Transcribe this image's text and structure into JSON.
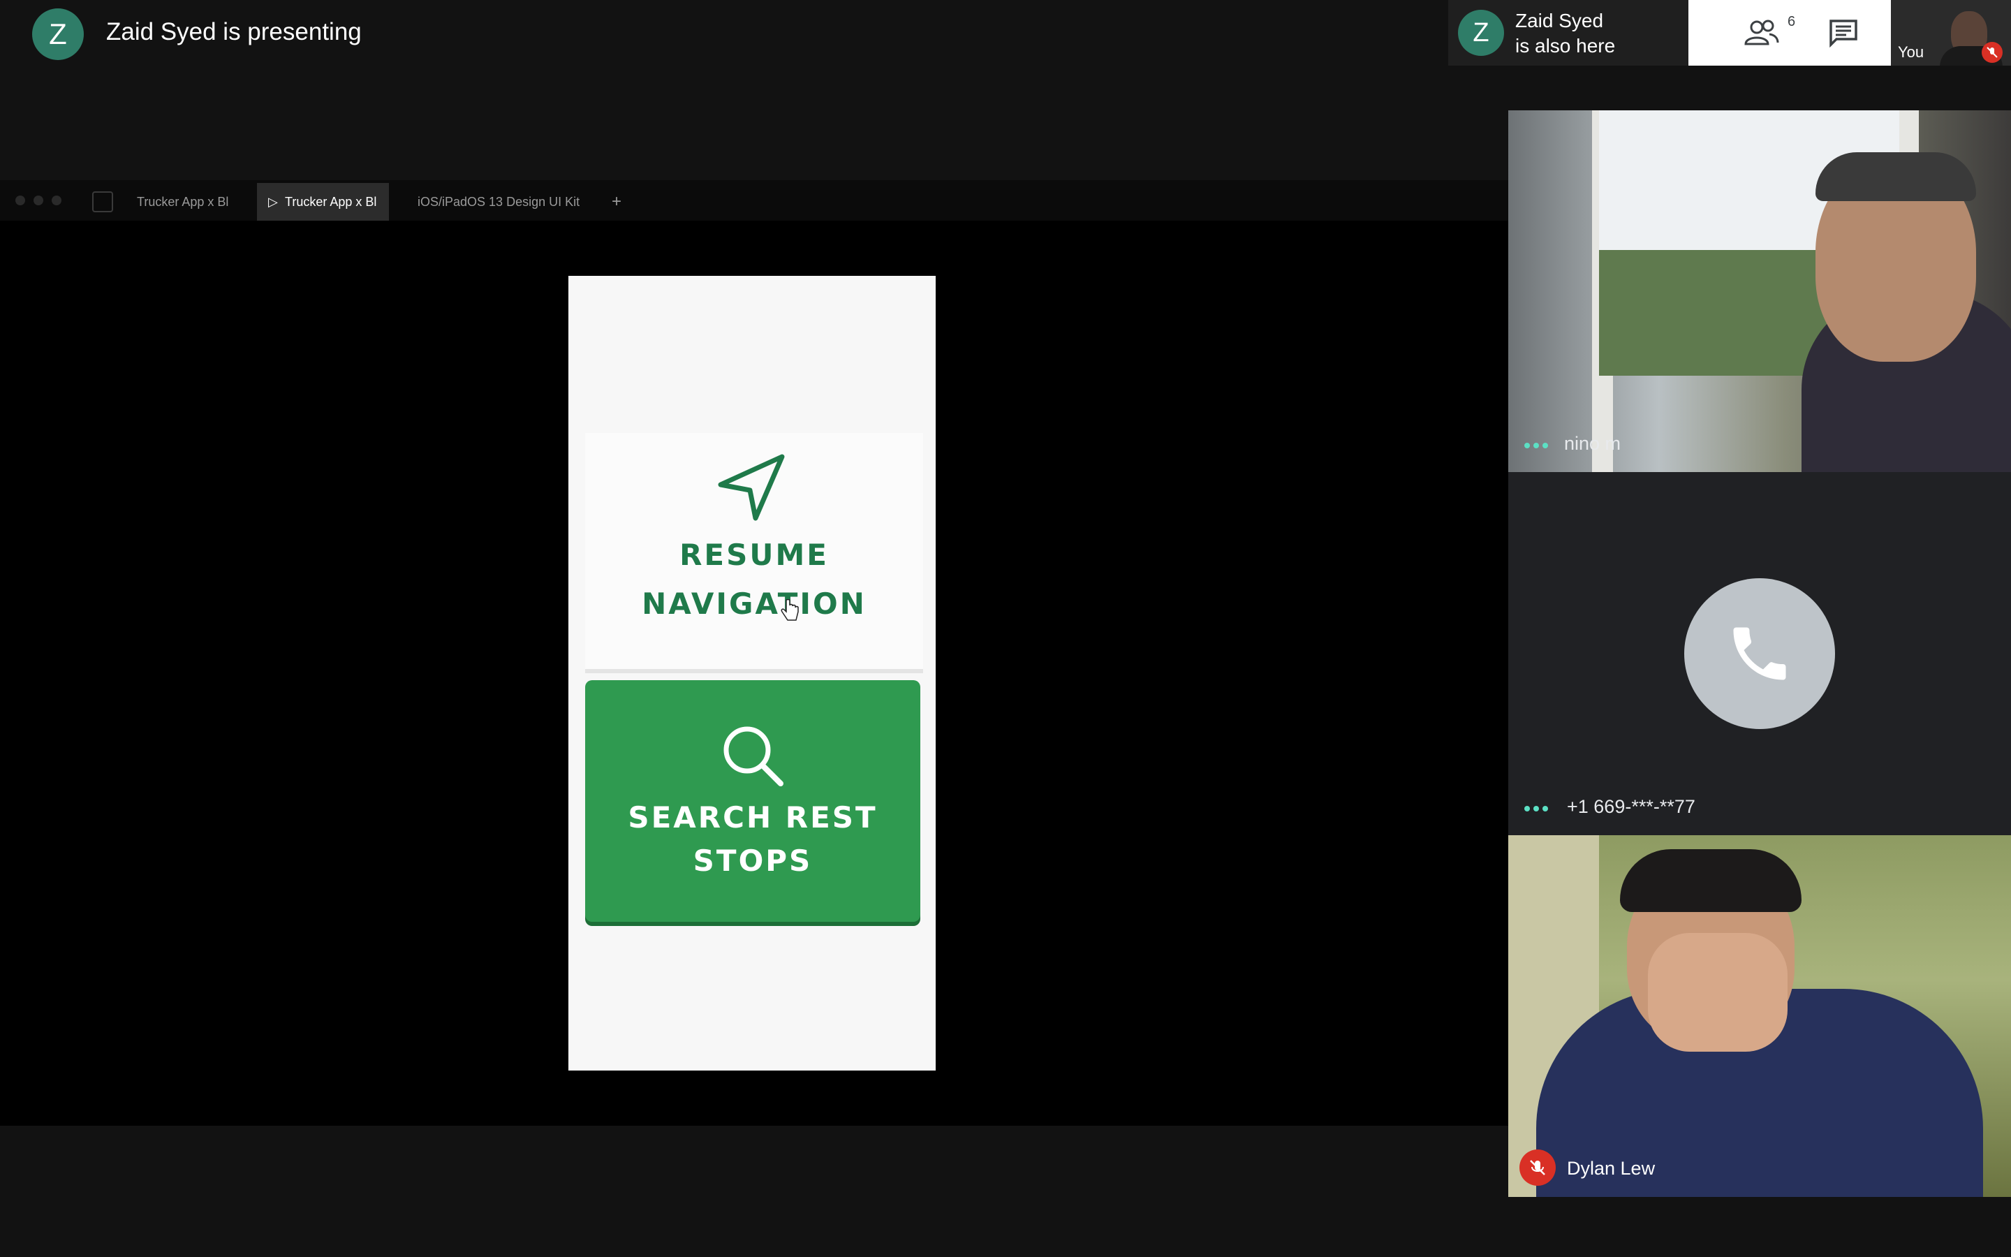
{
  "presenter": {
    "initial": "Z",
    "text": "Zaid Syed is presenting"
  },
  "also_here": {
    "initial": "Z",
    "line1": "Zaid Syed",
    "line2": "is also here"
  },
  "toolbar": {
    "people_icon": "people-icon",
    "people_count": "6",
    "chat_icon": "chat-icon"
  },
  "self_view": {
    "label": "You",
    "muted": true
  },
  "shared_screen": {
    "tabs": [
      "Trucker App x Bl",
      "Trucker App x Bl",
      "iOS/iPadOS 13 Design UI Kit",
      "+"
    ],
    "active_tab_index": 1,
    "resume": {
      "line1": "RESUME",
      "line2": "NAVIGATION",
      "icon": "navigation-arrow-icon"
    },
    "search": {
      "line1": "SEARCH REST",
      "line2": "STOPS",
      "icon": "search-icon"
    },
    "colors": {
      "resume_text": "#1f7a4a",
      "search_bg": "#2f9a50"
    }
  },
  "participants": [
    {
      "name": "nino m",
      "type": "video"
    },
    {
      "name": "+1 669-***-**77",
      "type": "phone"
    },
    {
      "name": "Dylan Lew",
      "type": "video",
      "muted": true
    }
  ]
}
